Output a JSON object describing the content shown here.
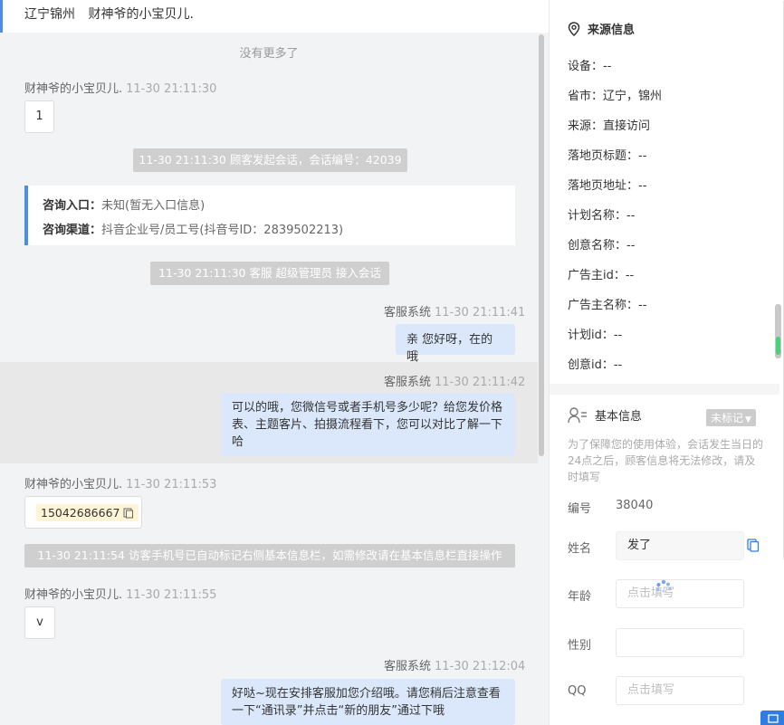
{
  "header": {
    "location": "辽宁锦州",
    "visitor": "财神爷的小宝贝儿."
  },
  "chat": {
    "no_more": "没有更多了",
    "msg1": {
      "sender": "财神爷的小宝贝儿.",
      "time": "11-30 21:11:30",
      "text": "1"
    },
    "sys1": "11-30 21:11:30 顾客发起会话，会话编号：42039",
    "consult": {
      "entry_label": "咨询入口：",
      "entry_value": "未知(暂无入口信息)",
      "channel_label": "咨询渠道：",
      "channel_value": "抖音企业号/员工号(抖音号ID：2839502213)"
    },
    "sys2": "11-30 21:11:30 客服 超级管理员 接入会话",
    "msg2": {
      "sender": "客服系统",
      "time": "11-30 21:11:41",
      "text": "亲 您好呀，在的哦"
    },
    "msg3": {
      "sender": "客服系统",
      "time": "11-30 21:11:42",
      "text": "可以的哦，您微信号或者手机号多少呢？给您发价格表、主题客片、拍摄流程看下，您可以对比了解一下哈"
    },
    "msg4": {
      "sender": "财神爷的小宝贝儿.",
      "time": "11-30 21:11:53",
      "text": "15042686667"
    },
    "sys3": "11-30 21:11:54 访客手机号已自动标记右侧基本信息栏，如需修改请在基本信息栏直接操作",
    "msg5": {
      "sender": "财神爷的小宝贝儿.",
      "time": "11-30 21:11:55",
      "text": "v"
    },
    "msg6": {
      "sender": "客服系统",
      "time": "11-30 21:12:04",
      "text": "好哒~现在安排客服加您介绍哦。请您稍后注意查看一下“通讯录”并点击“新的朋友”通过下哦"
    }
  },
  "source": {
    "title": "来源信息",
    "lines": [
      "设备：--",
      "省市：辽宁，锦州",
      "来源：直接访问",
      "落地页标题：--",
      "落地页地址：--",
      "计划名称：--",
      "创意名称：--",
      "广告主id：--",
      "广告主名称：--",
      "计划id：--",
      "创意id：--"
    ]
  },
  "basic": {
    "title": "基本信息",
    "tag": "未标记",
    "notice": "为了保障您的使用体验，会话发生当日的24点之后，顾客信息将无法修改，请及时填写",
    "id_label": "编号",
    "id_value": "38040",
    "name_label": "姓名",
    "name_value": "发了",
    "age_label": "年龄",
    "age_placeholder": "点击填写",
    "gender_label": "性别",
    "qq_label": "QQ",
    "qq_placeholder": "点击填写"
  }
}
